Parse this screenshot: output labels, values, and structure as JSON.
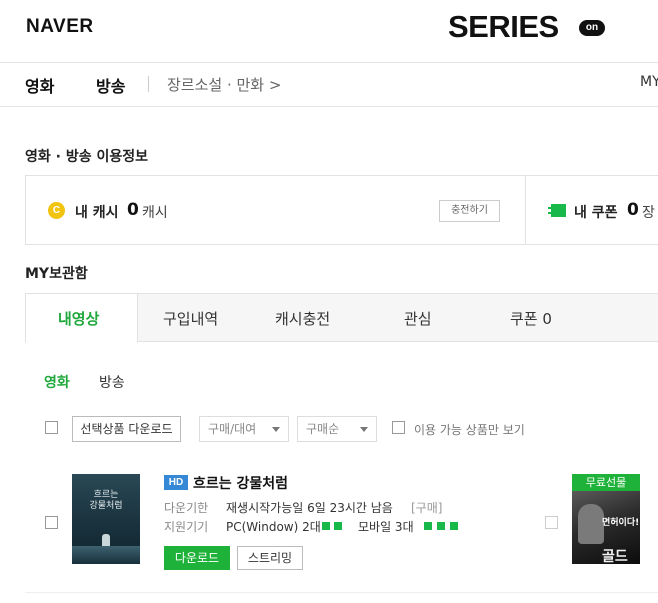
{
  "header": {
    "naver_logo": "NAVER",
    "series_logo": "SERIES",
    "series_on": "on"
  },
  "topnav": {
    "movie": "영화",
    "broadcast": "방송",
    "genre_link": "장르소설 · 만화 >",
    "my": "MY"
  },
  "usage_info": {
    "title": "영화 · 방송 이용정보",
    "coin_icon": "C",
    "cash_label": "내 캐시",
    "cash_value": "0",
    "cash_unit": "캐시",
    "charge_button": "충전하기",
    "coupon_label": "내 쿠폰",
    "coupon_value": "0",
    "coupon_unit": "장"
  },
  "storage": {
    "title": "MY보관함",
    "tabs": [
      {
        "label": "내영상"
      },
      {
        "label": "구입내역"
      },
      {
        "label": "캐시충전"
      },
      {
        "label": "관심"
      },
      {
        "label": "쿠폰 0"
      }
    ],
    "subtabs": [
      {
        "label": "영화"
      },
      {
        "label": "방송"
      }
    ]
  },
  "filters": {
    "download_selected": "선택상품 다운로드",
    "purchase_type": "구매/대여",
    "sort": "구매순",
    "available_only": "이용 가능 상품만 보기"
  },
  "product": {
    "poster_title": "흐르는\n강물처럼",
    "hd_badge": "HD",
    "title": "흐르는 강물처럼",
    "download_period_label": "다운기한",
    "download_period_value": "재생시작가능일 6일 23시간 남음",
    "download_period_note": "[구매]",
    "devices_label": "지원기기",
    "devices_pc": "PC(Window) 2대",
    "devices_mobile": "모바일 3대",
    "download_button": "다운로드",
    "streaming_button": "스트리밍"
  },
  "product2": {
    "free_badge": "무료선물",
    "poster_text": "면허이다!",
    "poster_title": "골드"
  },
  "colors": {
    "accent_green": "#1fa83b",
    "hd_blue": "#3488d6",
    "coin_yellow": "#f1c40f"
  }
}
